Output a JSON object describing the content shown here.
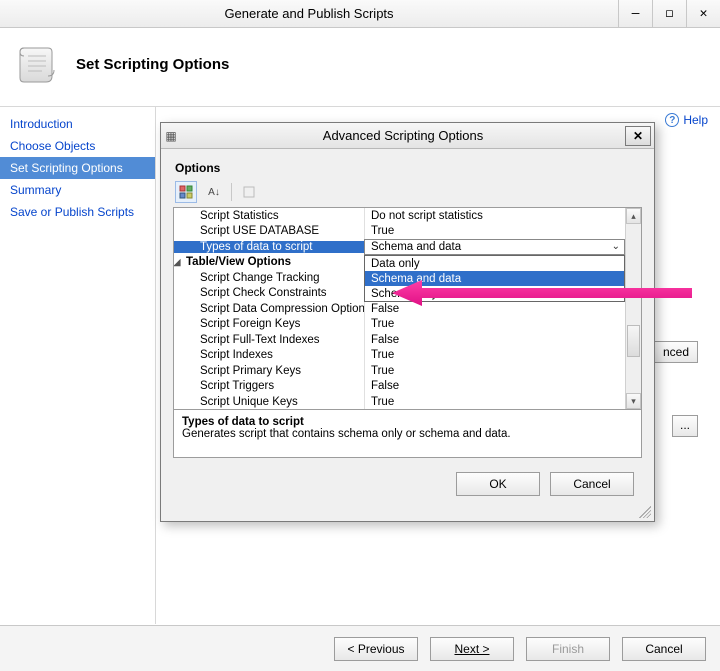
{
  "window": {
    "title": "Generate and Publish Scripts",
    "header_title": "Set Scripting Options",
    "help_label": "Help"
  },
  "nav": {
    "items": [
      {
        "label": "Introduction",
        "active": false
      },
      {
        "label": "Choose Objects",
        "active": false
      },
      {
        "label": "Set Scripting Options",
        "active": true
      },
      {
        "label": "Summary",
        "active": false
      },
      {
        "label": "Save or Publish Scripts",
        "active": false
      }
    ]
  },
  "wizard_buttons": {
    "previous": "< Previous",
    "next": "Next >",
    "finish": "Finish",
    "cancel": "Cancel"
  },
  "background_buttons": {
    "advanced_visible_fragment": "nced",
    "browse": "..."
  },
  "dialog": {
    "title": "Advanced Scripting Options",
    "section_label": "Options",
    "grid": {
      "rows": [
        {
          "label": "Script Statistics",
          "value": "Do not script statistics",
          "selected": false
        },
        {
          "label": "Script USE DATABASE",
          "value": "True",
          "selected": false
        },
        {
          "label": "Types of data to script",
          "value": "Schema and data",
          "selected": true,
          "has_dropdown": true
        },
        {
          "label": "Table/View Options",
          "value": "",
          "section": true
        },
        {
          "label": "Script Change Tracking",
          "value": "False",
          "selected": false
        },
        {
          "label": "Script Check Constraints",
          "value": "True",
          "selected": false
        },
        {
          "label": "Script Data Compression Options",
          "value": "False",
          "selected": false
        },
        {
          "label": "Script Foreign Keys",
          "value": "True",
          "selected": false
        },
        {
          "label": "Script Full-Text Indexes",
          "value": "False",
          "selected": false
        },
        {
          "label": "Script Indexes",
          "value": "True",
          "selected": false
        },
        {
          "label": "Script Primary Keys",
          "value": "True",
          "selected": false
        },
        {
          "label": "Script Triggers",
          "value": "False",
          "selected": false
        },
        {
          "label": "Script Unique Keys",
          "value": "True",
          "selected": false
        }
      ],
      "dropdown_options": [
        {
          "label": "Data only",
          "highlighted": false
        },
        {
          "label": "Schema and data",
          "highlighted": true
        },
        {
          "label": "Schema only",
          "highlighted": false
        }
      ]
    },
    "description": {
      "title": "Types of data to script",
      "text": "Generates script that contains schema only or schema and data."
    },
    "buttons": {
      "ok": "OK",
      "cancel": "Cancel"
    }
  }
}
